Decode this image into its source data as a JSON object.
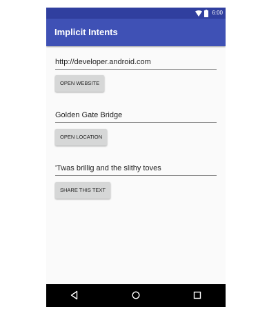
{
  "status_bar": {
    "time": "6:00",
    "icons": [
      "wifi-icon",
      "battery-icon"
    ],
    "background": "#303F9F"
  },
  "app_bar": {
    "title": "Implicit Intents",
    "background": "#3F51B5"
  },
  "main": {
    "website_field": {
      "value": "http://developer.android.com"
    },
    "open_website_button": {
      "label": "OPEN WEBSITE"
    },
    "location_field": {
      "value": "Golden Gate Bridge"
    },
    "open_location_button": {
      "label": "OPEN LOCATION"
    },
    "share_field": {
      "value": "'Twas brillig and the slithy toves"
    },
    "share_button": {
      "label": "SHARE THIS TEXT"
    }
  },
  "nav_bar": {
    "icons": [
      "back-icon",
      "home-icon",
      "recents-icon"
    ],
    "background": "#000000"
  }
}
